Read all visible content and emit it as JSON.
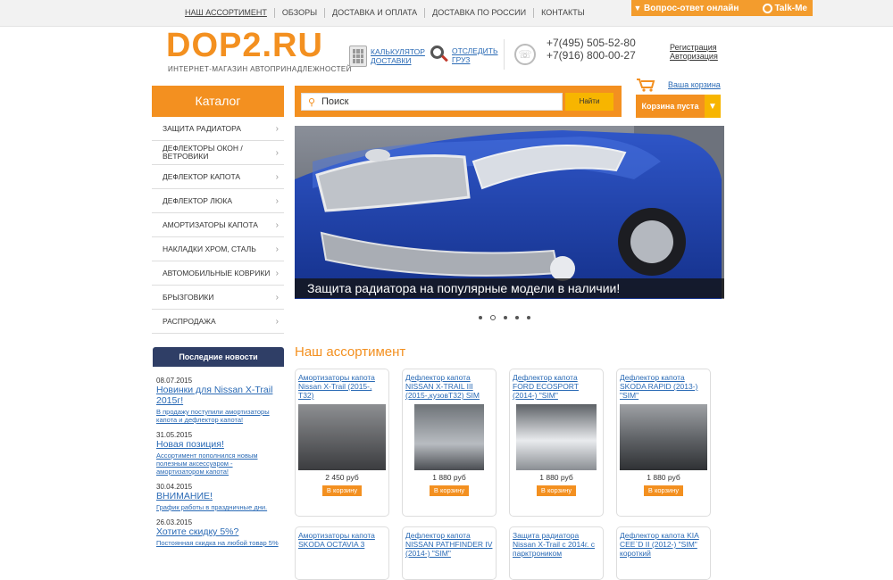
{
  "topnav": [
    "НАШ АССОРТИМЕНТ",
    "ОБЗОРЫ",
    "ДОСТАВКА И ОПЛАТА",
    "ДОСТАВКА ПО РОССИИ",
    "КОНТАКТЫ"
  ],
  "qa": {
    "label": "Вопрос-ответ онлайн",
    "talkme": "Talk-Me"
  },
  "logo": {
    "text": "DOP2.RU",
    "tagline": "ИНТЕРНЕТ-МАГАЗИН АВТОПРИНАДЛЕЖНОСТЕЙ"
  },
  "header": {
    "calc_line1": "КАЛЬКУЛЯТОР",
    "calc_line2": "ДОСТАВКИ",
    "track_line1": "ОТСЛЕДИТЬ",
    "track_line2": "ГРУЗ",
    "phone1": "+7(495) 505-52-80",
    "phone2": "+7(916) 800-00-27",
    "register": "Регистрация",
    "login": "Авторизация"
  },
  "cart": {
    "link": "Ваша корзина",
    "status": "Корзина пуста"
  },
  "catalog": {
    "title": "Каталог",
    "items": [
      "ЗАЩИТА РАДИАТОРА",
      "ДЕФЛЕКТОРЫ ОКОН / ВЕТРОВИКИ",
      "ДЕФЛЕКТОР КАПОТА",
      "ДЕФЛЕКТОР ЛЮКА",
      "АМОРТИЗАТОРЫ КАПОТА",
      "НАКЛАДКИ ХРОМ, СТАЛЬ",
      "АВТОМОБИЛЬНЫЕ КОВРИКИ",
      "БРЫЗГОВИКИ",
      "РАСПРОДАЖА"
    ]
  },
  "search": {
    "placeholder": "Поиск",
    "button": "Найти"
  },
  "slider": {
    "caption": "Защита радиатора на популярные модели в наличии!"
  },
  "news": {
    "title": "Последние новости",
    "items": [
      {
        "date": "08.07.2015",
        "title": "Новинки для Nissan X-Trail 2015г!",
        "desc": "В продажу поступили амортизаторы капота и дефлектор капота!"
      },
      {
        "date": "31.05.2015",
        "title": "Новая позиция!",
        "desc": "Ассортимент пополнился новым полезным аксессуаром - амортизатором капота!"
      },
      {
        "date": "30.04.2015",
        "title": "ВНИМАНИЕ!",
        "desc": "График работы в праздничные дни."
      },
      {
        "date": "26.03.2015",
        "title": "Хотите скидку 5%?",
        "desc": "Постоянная скидка на любой товар 5%"
      }
    ]
  },
  "assortment": {
    "title": "Наш ассортимент",
    "products": [
      {
        "name": "Амортизаторы капота Nissan X-Trail (2015-, T32)",
        "price": "2 450 руб",
        "button": "В корзину"
      },
      {
        "name": "Дефлектор капота NISSAN X-TRAIL III (2015-,кузовT32) SIM",
        "price": "1 880 руб",
        "button": "В корзину"
      },
      {
        "name": "Дефлектор капота FORD ECOSPORT (2014-) \"SIM\"",
        "price": "1 880 руб",
        "button": "В корзину"
      },
      {
        "name": "Дефлектор капота SKODA RAPID (2013-) \"SIM\"",
        "price": "1 880 руб",
        "button": "В корзину"
      },
      {
        "name": "Амортизаторы капота SKODA OCTAVIA 3",
        "price": "",
        "button": ""
      },
      {
        "name": "Дефлектор капота NISSAN PATHFINDER IV (2014-) \"SIM\"",
        "price": "",
        "button": ""
      },
      {
        "name": "Защита радиатора Nissan X-Trail с 2014г. с парктроником",
        "price": "",
        "button": ""
      },
      {
        "name": "Дефлектор капота KIA CEE`D II (2012-) \"SIM\" короткий",
        "price": "",
        "button": ""
      }
    ]
  },
  "colors": {
    "accent": "#f39020",
    "yellow": "#f7b500",
    "navy": "#2f3e66",
    "link": "#2a6ab5"
  }
}
